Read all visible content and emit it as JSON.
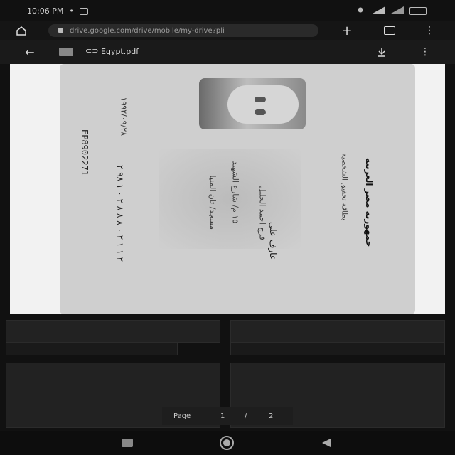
{
  "status_bar": {
    "time": "10:06 PM",
    "extra": "•",
    "icons": [
      "notification-icon",
      "signal-icon",
      "wifi-icon",
      "battery-icon"
    ]
  },
  "browser": {
    "url": "drive.google.com/drive/mobile/my-drive?pli"
  },
  "viewer_toolbar": {
    "file_name": "Egypt.pdf"
  },
  "id_card": {
    "serial": "EP8902271",
    "dob": "۱۹۹۲/۰۹/۲۸",
    "header_ar": "جمهورية مصر العربية",
    "subheader_ar": "بطاقة تحقيق الشخصية",
    "name_ar": "عارف على",
    "name2_ar": "فرج احمد الجليل",
    "address1_ar": "١٥ م/ شارع الشهيد",
    "address2_ar": "مسجد/ ثان المنيا",
    "number_ar": "۲ ۹۸ ۱ ۰ ۲ ۸ ۸ ۸ ۰ ۲ ۱ ۱ ۲"
  },
  "pager": {
    "label": "Page",
    "current": "1",
    "separator": "/",
    "total": "2"
  }
}
